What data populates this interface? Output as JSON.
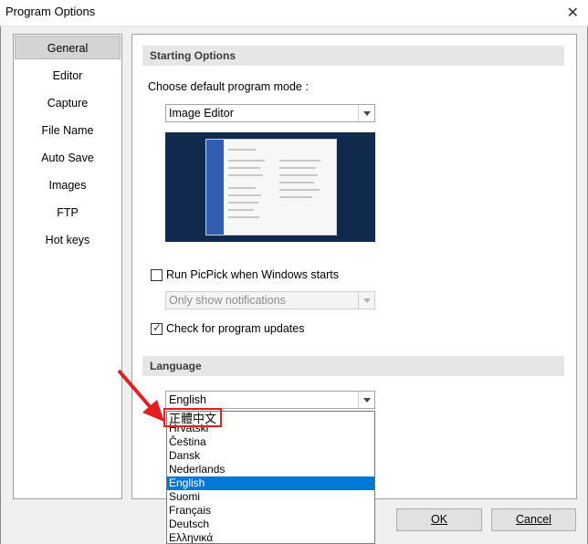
{
  "window": {
    "title": "Program Options",
    "close_glyph": "✕"
  },
  "nav": {
    "items": [
      "General",
      "Editor",
      "Capture",
      "File Name",
      "Auto Save",
      "Images",
      "FTP",
      "Hot keys"
    ],
    "selected_index": 0
  },
  "starting_options": {
    "header": "Starting Options",
    "mode_label": "Choose default program mode :",
    "mode_value": "Image Editor",
    "run_on_start_label": "Run PicPick when Windows starts",
    "run_on_start_checked": false,
    "notification_value": "Only show notifications",
    "check_updates_label": "Check for program updates",
    "check_updates_checked": true
  },
  "language": {
    "header": "Language",
    "current": "English",
    "options": [
      "正體中文",
      "Hrvatski",
      "Čeština",
      "Dansk",
      "Nederlands",
      "English",
      "Suomi",
      "Français",
      "Deutsch",
      "Ελληνικά"
    ],
    "selected_option": "English"
  },
  "buttons": {
    "ok": "OK",
    "cancel": "Cancel"
  },
  "colors": {
    "accent": "#0078d7",
    "annotation": "#e02020"
  }
}
